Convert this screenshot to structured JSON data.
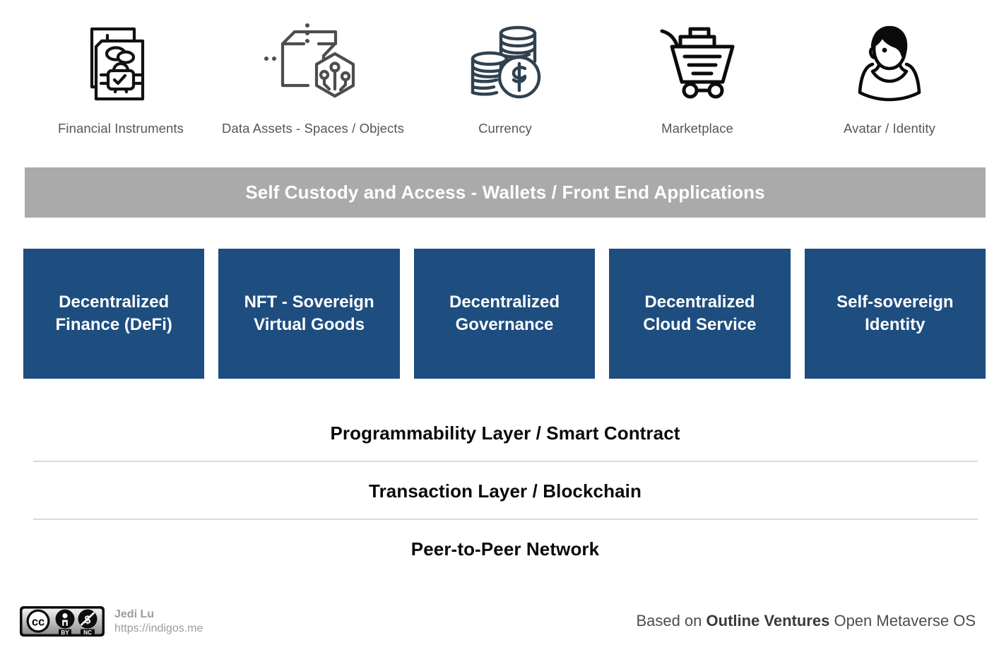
{
  "top_icons": [
    {
      "icon": "documents-lock-icon",
      "label": "Financial Instruments"
    },
    {
      "icon": "cube-hexagon-circuit-icon",
      "label": "Data Assets - Spaces / Objects"
    },
    {
      "icon": "coin-stacks-dollar-icon",
      "label": "Currency"
    },
    {
      "icon": "shopping-cart-icon",
      "label": "Marketplace"
    },
    {
      "icon": "person-avatar-icon",
      "label": "Avatar / Identity"
    }
  ],
  "access_band": {
    "label": "Self Custody and Access - Wallets / Front End Applications",
    "background": "#aaaaaa",
    "text_color": "#ffffff"
  },
  "pillars": [
    {
      "label": "Decentralized\nFinance (DeFi)"
    },
    {
      "label": "NFT - Sovereign\nVirtual Goods"
    },
    {
      "label": "Decentralized\nGovernance"
    },
    {
      "label": "Decentralized\nCloud Service"
    },
    {
      "label": "Self-sovereign\nIdentity"
    }
  ],
  "pillar_color": "#1e4d7f",
  "stack_layers": [
    {
      "label": "Programmability Layer / Smart Contract"
    },
    {
      "label": "Transaction Layer / Blockchain"
    },
    {
      "label": "Peer-to-Peer Network"
    }
  ],
  "footer": {
    "license_badge": "cc-by-nc-badge",
    "license_marks": {
      "cc": "CC",
      "by": "BY",
      "nc": "NC"
    },
    "author_name": "Jedi Lu",
    "author_url": "https://indigos.me",
    "attribution_prefix": "Based on ",
    "attribution_bold": "Outline Ventures",
    "attribution_suffix": " Open Metaverse OS"
  }
}
